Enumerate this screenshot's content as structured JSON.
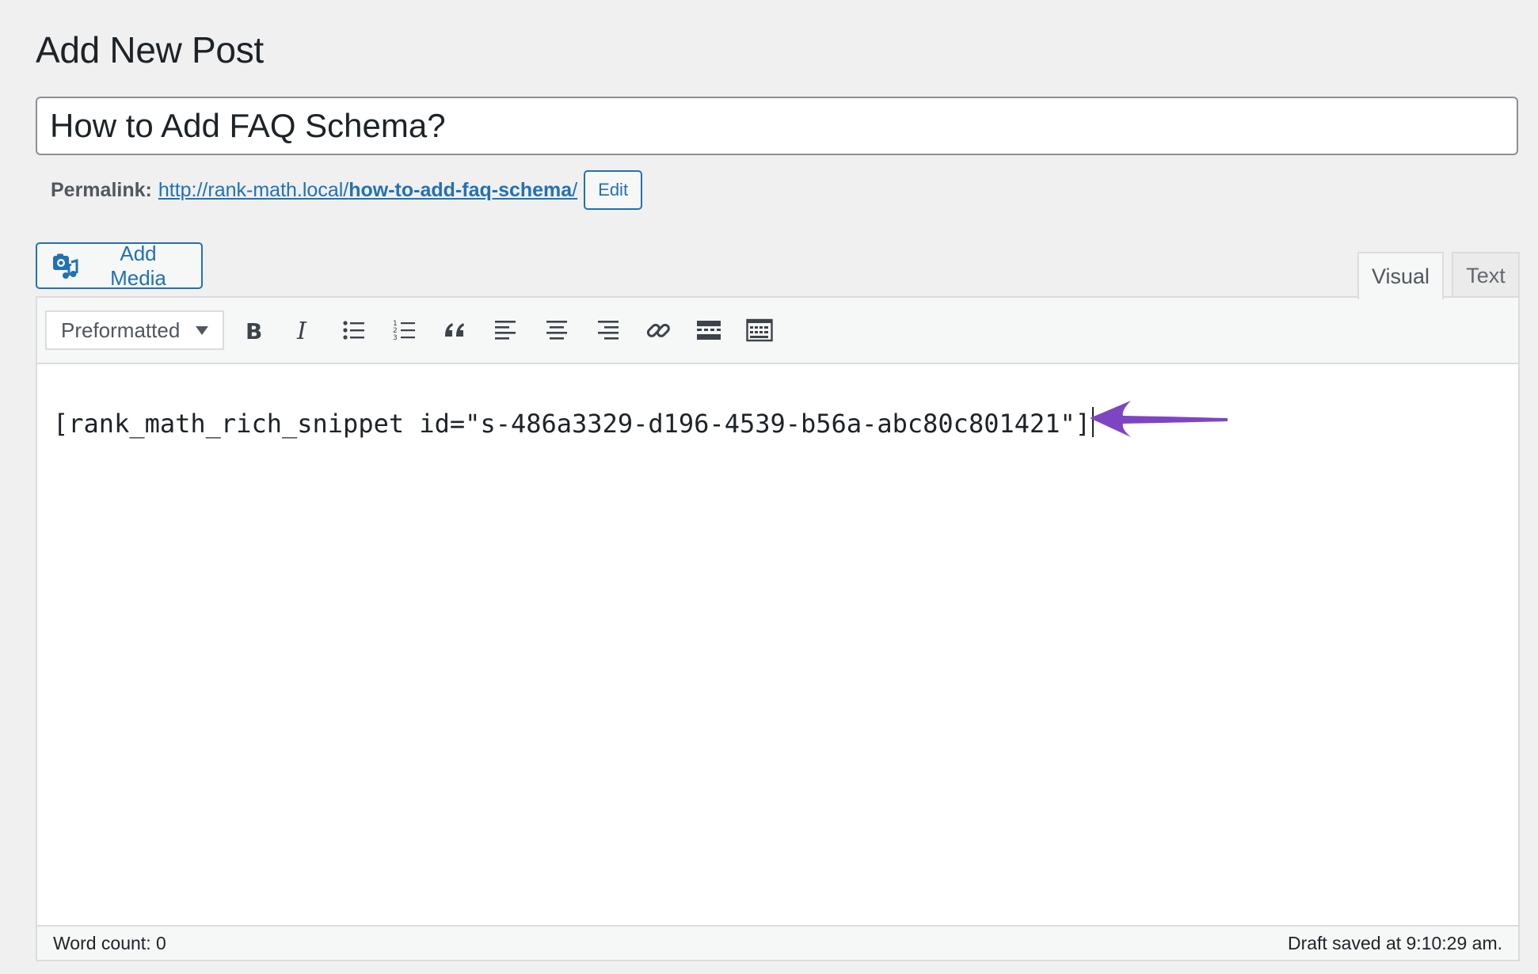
{
  "page": {
    "title": "Add New Post"
  },
  "post": {
    "title_value": "How to Add FAQ Schema?",
    "title_placeholder": "Add title"
  },
  "permalink": {
    "label": "Permalink:",
    "base": "http://rank-math.local/",
    "slug": "how-to-add-faq-schema",
    "trailing": "/",
    "edit_label": "Edit"
  },
  "media": {
    "add_label": "Add Media"
  },
  "editor_tabs": [
    {
      "label": "Visual",
      "active": true
    },
    {
      "label": "Text",
      "active": false
    }
  ],
  "toolbar": {
    "format_selected": "Preformatted",
    "buttons": [
      "bold-icon",
      "italic-icon",
      "bulleted-list-icon",
      "numbered-list-icon",
      "blockquote-icon",
      "align-left-icon",
      "align-center-icon",
      "align-right-icon",
      "link-icon",
      "read-more-icon",
      "toolbar-toggle-icon"
    ]
  },
  "content": {
    "shortcode": "[rank_math_rich_snippet id=\"s-486a3329-d196-4539-b56a-abc80c801421\"]"
  },
  "annotation": {
    "arrow_color": "#7e45c2"
  },
  "status": {
    "word_count": "Word count: 0",
    "draft_saved": "Draft saved at 9:10:29 am."
  },
  "colors": {
    "accent": "#2271b1",
    "background": "#f0f0f1",
    "border": "#dcdcde"
  }
}
